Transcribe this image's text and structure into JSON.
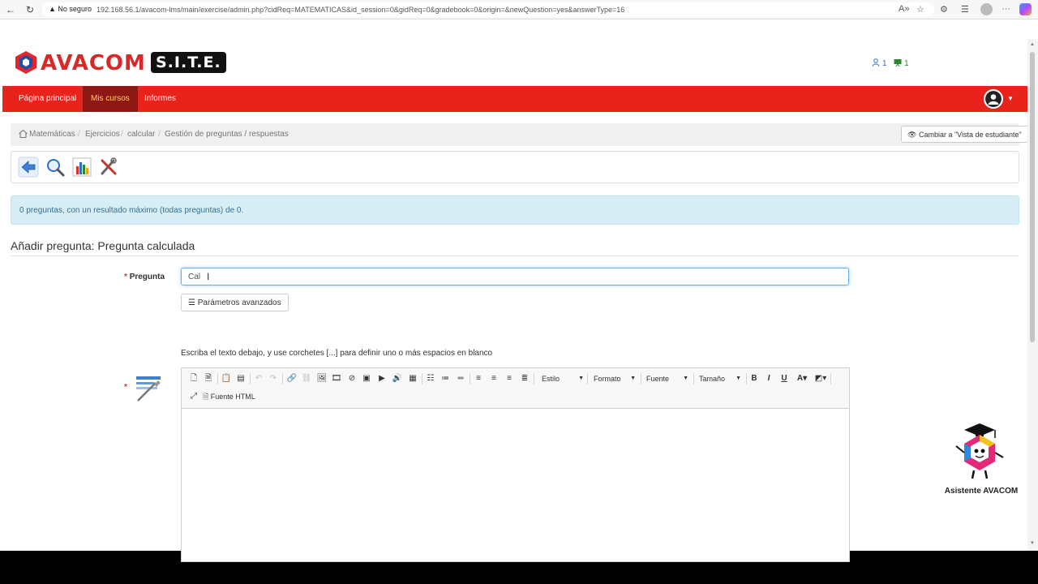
{
  "browser": {
    "security_label": "No seguro",
    "url": "192.168.56.1/avacom-lms/main/exercise/admin.php?cidReq=MATEMATICAS&id_session=0&gidReq=0&gradebook=0&origin=&newQuestion=yes&answerType=16"
  },
  "header": {
    "logo_text": "AVACOM",
    "logo_badge": "S.I.T.E.",
    "users_count": "1",
    "courses_count": "1"
  },
  "nav": {
    "items": [
      {
        "label": "Página principal"
      },
      {
        "label": "Mis cursos"
      },
      {
        "label": "Informes"
      }
    ]
  },
  "breadcrumb": {
    "items": [
      "Matemáticas",
      "Ejercicios",
      "calcular",
      "Gestión de preguntas / respuestas"
    ],
    "student_view_label": "Cambiar a \"Vista de estudiante\""
  },
  "info": {
    "message": "0 preguntas, con un resultado máximo (todas preguntas) de 0."
  },
  "form": {
    "title": "Añadir pregunta: Pregunta calculada",
    "question_label": "Pregunta",
    "question_value": "Cal",
    "advanced_label": "Parámetros avanzados",
    "hint": "Escriba el texto debajo, y use corchetes [...] para definir uno o más espacios en blanco"
  },
  "editor": {
    "style_label": "Estilo",
    "format_label": "Formato",
    "font_label": "Fuente",
    "size_label": "Tamaño",
    "source_label": "Fuente HTML"
  },
  "assistant": {
    "label": "Asistente AVACOM"
  },
  "colors": {
    "nav_red": "#e8231b",
    "nav_active": "#8f1714",
    "info_bg": "#d9edf7"
  }
}
